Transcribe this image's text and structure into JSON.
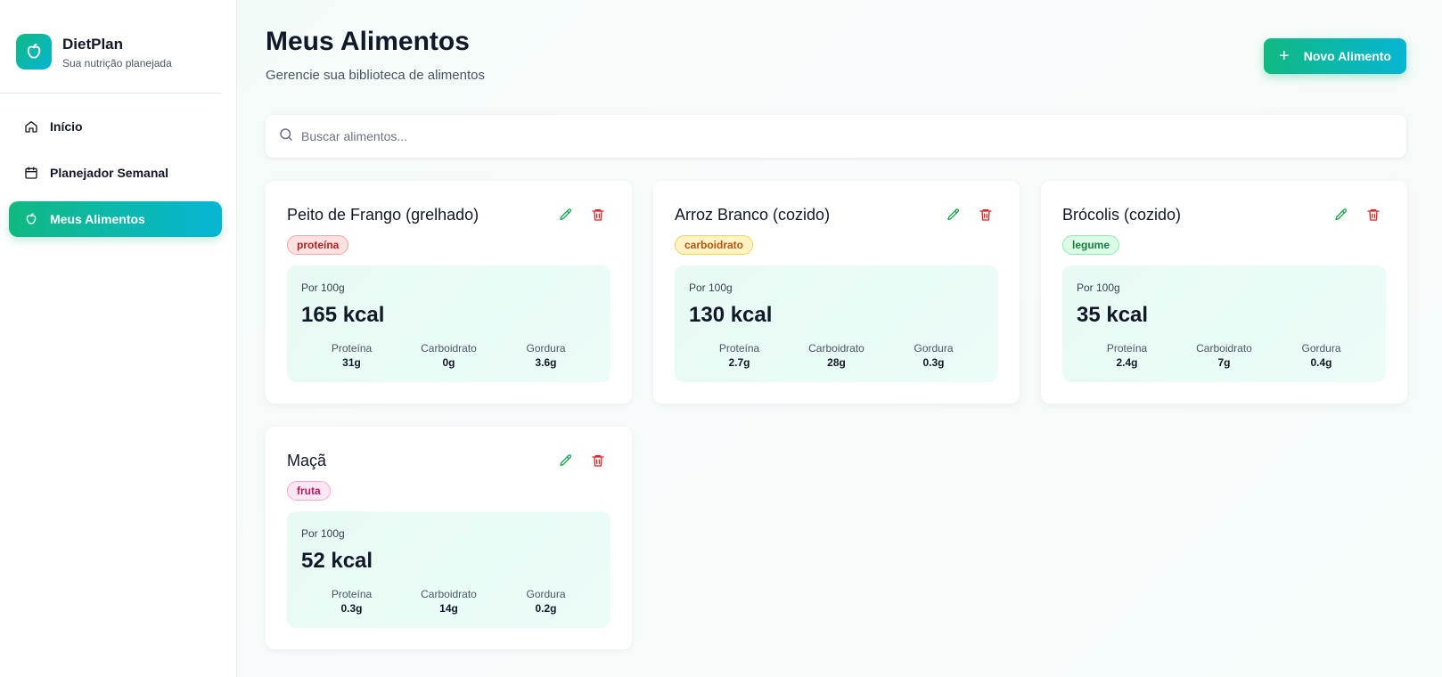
{
  "app": {
    "name": "DietPlan",
    "tagline": "Sua nutrição planejada"
  },
  "sidebar": {
    "items": [
      {
        "label": "Início",
        "icon": "home-icon",
        "active": false
      },
      {
        "label": "Planejador Semanal",
        "icon": "calendar-icon",
        "active": false
      },
      {
        "label": "Meus Alimentos",
        "icon": "apple-icon",
        "active": true
      }
    ]
  },
  "header": {
    "title": "Meus Alimentos",
    "subtitle": "Gerencie sua biblioteca de alimentos",
    "new_button_label": "Novo Alimento"
  },
  "search": {
    "placeholder": "Buscar alimentos...",
    "value": ""
  },
  "colors": {
    "accent_start": "#10b981",
    "accent_end": "#06b6d4",
    "edit": "#16a34a",
    "delete": "#dc2626"
  },
  "foods": [
    {
      "name": "Peito de Frango (grelhado)",
      "category": "proteína",
      "per": "Por 100g",
      "kcal": "165 kcal",
      "macros": [
        {
          "label": "Proteína",
          "value": "31g"
        },
        {
          "label": "Carboidrato",
          "value": "0g"
        },
        {
          "label": "Gordura",
          "value": "3.6g"
        }
      ]
    },
    {
      "name": "Arroz Branco (cozido)",
      "category": "carboidrato",
      "per": "Por 100g",
      "kcal": "130 kcal",
      "macros": [
        {
          "label": "Proteína",
          "value": "2.7g"
        },
        {
          "label": "Carboidrato",
          "value": "28g"
        },
        {
          "label": "Gordura",
          "value": "0.3g"
        }
      ]
    },
    {
      "name": "Brócolis (cozido)",
      "category": "legume",
      "per": "Por 100g",
      "kcal": "35 kcal",
      "macros": [
        {
          "label": "Proteína",
          "value": "2.4g"
        },
        {
          "label": "Carboidrato",
          "value": "7g"
        },
        {
          "label": "Gordura",
          "value": "0.4g"
        }
      ]
    },
    {
      "name": "Maçã",
      "category": "fruta",
      "per": "Por 100g",
      "kcal": "52 kcal",
      "macros": [
        {
          "label": "Proteína",
          "value": "0.3g"
        },
        {
          "label": "Carboidrato",
          "value": "14g"
        },
        {
          "label": "Gordura",
          "value": "0.2g"
        }
      ]
    }
  ]
}
